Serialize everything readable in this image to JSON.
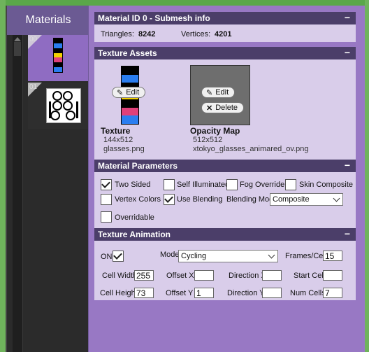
{
  "left": {
    "header": "Materials",
    "items": [
      {
        "index": "00",
        "selected": true
      },
      {
        "index": "01",
        "selected": false
      }
    ]
  },
  "submesh": {
    "title": "Material ID 0 - Submesh info",
    "triangles_label": "Triangles:",
    "triangles_value": "8242",
    "vertices_label": "Vertices:",
    "vertices_value": "4201"
  },
  "textures": {
    "title": "Texture Assets",
    "texture": {
      "name": "Texture",
      "size": "144x512",
      "file": "glasses.png",
      "edit": "Edit"
    },
    "opacity": {
      "name": "Opacity Map",
      "size": "512x512",
      "file": "xtokyo_glasses_animared_ov.png",
      "edit": "Edit",
      "delete": "Delete"
    }
  },
  "params": {
    "title": "Material Parameters",
    "two_sided": {
      "label": "Two Sided",
      "checked": true
    },
    "self_illuminated": {
      "label": "Self Illuminated",
      "checked": false
    },
    "fog_override": {
      "label": "Fog Override",
      "checked": false
    },
    "skin_composite": {
      "label": "Skin Composite",
      "checked": false
    },
    "vertex_colors": {
      "label": "Vertex Colors",
      "checked": false
    },
    "use_blending": {
      "label": "Use Blending",
      "checked": true
    },
    "blending_mode_label": "Blending Mode",
    "blending_mode_value": "Composite",
    "overridable": {
      "label": "Overridable",
      "checked": false
    }
  },
  "anim": {
    "title": "Texture Animation",
    "on_label": "ON",
    "on_checked": true,
    "mode_label": "Mode",
    "mode_value": "Cycling",
    "frames_label": "Frames/Cell",
    "frames_value": "15",
    "cell_width_label": "Cell Width",
    "cell_width_value": "255",
    "offset_x_label": "Offset X",
    "offset_x_value": "",
    "direction_x_label": "Direction X",
    "direction_x_value": "",
    "start_cell_label": "Start Cell",
    "start_cell_value": "",
    "cell_height_label": "Cell Height",
    "cell_height_value": "73",
    "offset_y_label": "Offset Y",
    "offset_y_value": "1",
    "direction_y_label": "Direction Y",
    "direction_y_value": "",
    "num_cells_label": "Num Cells",
    "num_cells_value": "7"
  },
  "colors": {
    "accent": "#8f6cc2",
    "section_header": "#4b3e69",
    "section_body": "#d9cdea",
    "panel_bg": "#9878c4",
    "outer_green": "#5aa74a"
  }
}
